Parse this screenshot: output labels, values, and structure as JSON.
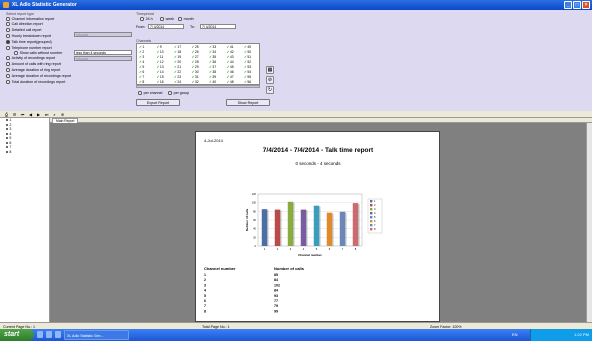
{
  "window": {
    "title": "XL Adlo Statistic Generator"
  },
  "report_type": {
    "title": "Select report type",
    "options": [
      "Channel information report",
      "Call direction report",
      "Detailed call report",
      "Hourly breakdown report",
      "Talk time report(grouped)",
      "Telephone number report",
      "Show calls without number",
      "Activity of recordings report",
      "Amount of calls with ring report",
      "Average duration of ring report",
      "Average duration of recordings report",
      "Total duration of recordings report"
    ],
    "call_direction_select": "Inbound",
    "talk_time_select": "less than 4 seconds",
    "telephone_select": "Inbound"
  },
  "timeperiod": {
    "title": "Timeperiod",
    "day": "24 h",
    "week": "week",
    "month": "month",
    "from_label": "From:",
    "from_value": "7/ 4/2014",
    "to_label": "To:",
    "to_value": "7/ 4/2014"
  },
  "channels": {
    "title": "Channels",
    "columns": [
      [
        "1",
        "2",
        "3",
        "4",
        "5",
        "6",
        "7",
        "8"
      ],
      [
        "9",
        "10",
        "11",
        "12",
        "13",
        "14",
        "15",
        "16"
      ],
      [
        "17",
        "18",
        "19",
        "20",
        "21",
        "22",
        "23",
        "24"
      ],
      [
        "25",
        "26",
        "27",
        "28",
        "29",
        "30",
        "31",
        "32"
      ],
      [
        "33",
        "34",
        "35",
        "36",
        "37",
        "38",
        "39",
        "40"
      ],
      [
        "41",
        "42",
        "43",
        "44",
        "45",
        "46",
        "47",
        "48"
      ],
      [
        "49",
        "50",
        "51",
        "52",
        "53",
        "54",
        "55",
        "56"
      ]
    ],
    "per_channel": "per channel",
    "per_group": "per group"
  },
  "buttons": {
    "export": "Export Report",
    "show": "Show Report"
  },
  "tree": {
    "items": [
      "1",
      "2",
      "3",
      "4",
      "5",
      "6",
      "7",
      "8"
    ]
  },
  "tabs": {
    "main": "Main Report"
  },
  "report": {
    "date": "4-Jul-2014",
    "title": "7/4/2014 - 7/4/2014     - Talk time report",
    "subtitle": "0 seconds  -  4 seconds",
    "table_header_channel": "Channel number",
    "table_header_calls": "Number of calls",
    "rows": [
      [
        "1",
        "85"
      ],
      [
        "2",
        "84"
      ],
      [
        "3",
        "102"
      ],
      [
        "4",
        "84"
      ],
      [
        "5",
        "93"
      ],
      [
        "6",
        "77"
      ],
      [
        "7",
        "79"
      ],
      [
        "8",
        "99"
      ]
    ]
  },
  "chart_data": {
    "type": "bar",
    "categories": [
      "1",
      "2",
      "3",
      "4",
      "5",
      "6",
      "7",
      "8"
    ],
    "values": [
      85,
      84,
      102,
      84,
      93,
      77,
      79,
      99
    ],
    "colors": [
      "#4a6fa5",
      "#b94a48",
      "#8aab3f",
      "#7a5aa0",
      "#3a9dbd",
      "#e08a2c",
      "#6b86b8",
      "#c96b70"
    ],
    "legend": [
      "1",
      "2",
      "3",
      "4",
      "5",
      "6",
      "7",
      "8"
    ],
    "xlabel": "Channel number",
    "ylabel": "Number of calls",
    "ylim": [
      0,
      120
    ],
    "yticks": [
      "0",
      "20",
      "40",
      "60",
      "80",
      "100",
      "120"
    ]
  },
  "status": {
    "current_page": "Current Page No.: 1",
    "total_page": "Total Page No.: 1",
    "zoom": "Zoom Factor: 100%"
  },
  "taskbar": {
    "start": "start",
    "item": "XL Adlo Statistic Gen...",
    "lang": "EN",
    "clock": "1:22 PM"
  }
}
